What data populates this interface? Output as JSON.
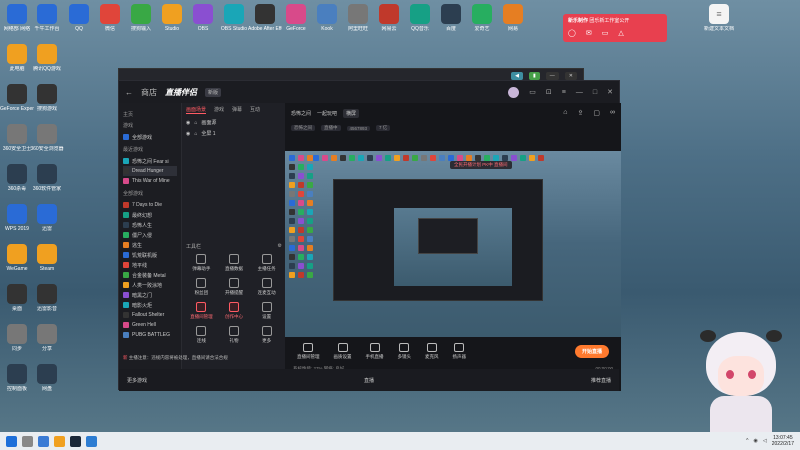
{
  "desktop": {
    "col1": [
      "网络部 网络",
      "此电脑",
      "GeForce Experience",
      "360安全卫士",
      "360杀毒",
      "WPS 2019",
      "WeGame",
      "桌面",
      "同步",
      "控制面板"
    ],
    "col2": [
      "千牛工作台",
      "腾讯QQ游戏",
      "搜狗游戏",
      "360安全浏览器",
      "360软件管家",
      "迅雷",
      "Steam",
      "迅雷影音",
      "分享",
      "网盘"
    ],
    "top_row": [
      "QQ",
      "微信",
      "搜狗输入",
      "Studio",
      "OBS",
      "OBS Studio",
      "Adobe After Effects",
      "GeForce",
      "Kook",
      "阿里旺旺",
      "网易云",
      "QQ音乐",
      "百度",
      "爱奇艺",
      "网易"
    ],
    "right_icon": "新建文本文档"
  },
  "notification": {
    "title": "新乐制作",
    "text": "团乐新工作室公开"
  },
  "app": {
    "logo": "直播伴侣",
    "version": "新版",
    "nav_title": "商店",
    "back": "←",
    "sidebar": {
      "section_top": "主页",
      "sections": [
        {
          "title": "游戏",
          "items": [
            "全部游戏"
          ]
        },
        {
          "title": "最近游戏",
          "items": [
            "恐怖之间 Fear si",
            "Dread Hunger",
            "This War of Mine"
          ]
        },
        {
          "title": "全部游戏",
          "items": [
            "7 Days to Die",
            "最终幻想",
            "恐怖人生",
            "僵尸入侵",
            "逃生",
            "饥荒联机版",
            "地平线",
            "合金装备 Metal",
            "人类一败涂地",
            "暗黑之门",
            "暗影火炬",
            "Fallout Shelter",
            "Green Hell",
            "PUBG BATTLEG"
          ]
        }
      ],
      "footer": "更多游戏"
    },
    "scene": {
      "tabs": [
        "画面场景",
        "游戏",
        "弹幕",
        "互动"
      ],
      "layers": [
        "画面源",
        "全屏 1"
      ],
      "tools_title": "工具栏",
      "tools": [
        "弹幕助手",
        "直播数据",
        "主播任务",
        "粉丝团",
        "开播提醒",
        "连麦互动",
        "直播间管理",
        "创作中心",
        "设置",
        "连线",
        "礼物",
        "更多"
      ]
    },
    "preview": {
      "tabs": [
        "恐怖之间",
        "一起玩吧",
        "横屏"
      ],
      "sub": [
        "恐怖之间",
        "直播中",
        "4567893",
        "7 亿"
      ],
      "controls": [
        "直播间管理",
        "画质设置",
        "手机直播",
        "多镜头",
        "麦克风",
        "扬声器"
      ],
      "go_live": "开始直播",
      "float_tag": "全民开播计划 PK中 直播间",
      "status_left": "系统性能: 27% 网络: 良好",
      "status_right": "00:00:00",
      "notice_badge": "新",
      "notice": "主播注意：违规内容将被处理，直播间请合法合规"
    },
    "bottom": {
      "left": "更多游戏",
      "center": "直播",
      "right": "推荐直播"
    }
  },
  "taskbar": {
    "time": "13:07:45",
    "date": "2022/2/17"
  }
}
